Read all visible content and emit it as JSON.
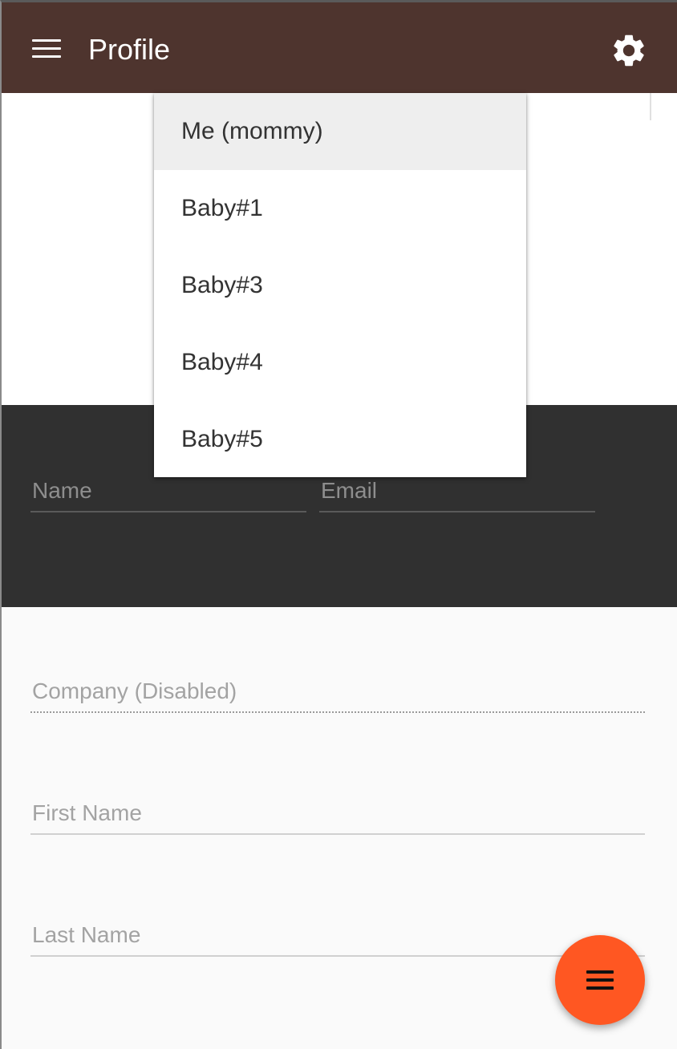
{
  "app_bar": {
    "title": "Profile",
    "menu_icon": "hamburger-menu-icon",
    "settings_icon": "gear-icon",
    "background_color": "#4e342e"
  },
  "dropdown": {
    "items": [
      {
        "label": "Me (mommy)",
        "selected": true
      },
      {
        "label": "Baby#1",
        "selected": false
      },
      {
        "label": "Baby#3",
        "selected": false
      },
      {
        "label": "Baby#4",
        "selected": false
      },
      {
        "label": "Baby#5",
        "selected": false
      }
    ]
  },
  "dark_form": {
    "name_placeholder": "Name",
    "email_placeholder": "Email"
  },
  "form": {
    "company_placeholder": "Company (Disabled)",
    "first_name_placeholder": "First Name",
    "last_name_placeholder": "Last Name"
  },
  "fab": {
    "icon": "hamburger-menu-icon",
    "color": "#ff5722"
  }
}
